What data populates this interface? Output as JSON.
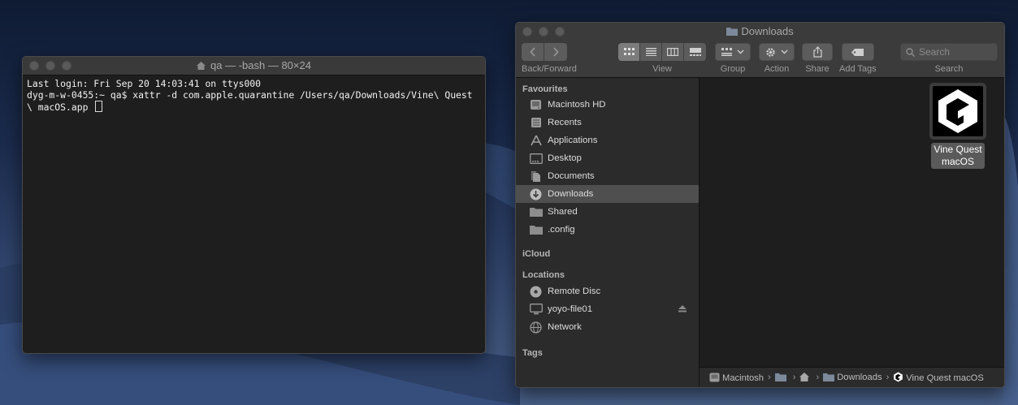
{
  "terminal": {
    "title": "qa — -bash — 80×24",
    "lines": [
      "Last login: Fri Sep 20 14:03:41 on ttys000",
      "dyg-m-w-0455:~ qa$ xattr -d com.apple.quarantine /Users/qa/Downloads/Vine\\ Quest",
      "\\ macOS.app "
    ]
  },
  "finder": {
    "title": "Downloads",
    "toolbar": {
      "back_forward_label": "Back/Forward",
      "view_label": "View",
      "group_label": "Group",
      "action_label": "Action",
      "share_label": "Share",
      "add_tags_label": "Add Tags",
      "search_label": "Search",
      "search_placeholder": "Search"
    },
    "sidebar": {
      "favourites_heading": "Favourites",
      "favourites": [
        {
          "label": "Macintosh HD",
          "icon": "hard-drive-icon"
        },
        {
          "label": "Recents",
          "icon": "recents-icon"
        },
        {
          "label": "Applications",
          "icon": "applications-icon"
        },
        {
          "label": "Desktop",
          "icon": "desktop-icon"
        },
        {
          "label": "Documents",
          "icon": "documents-icon"
        },
        {
          "label": "Downloads",
          "icon": "downloads-icon",
          "selected": true
        },
        {
          "label": "Shared",
          "icon": "folder-icon"
        },
        {
          "label": ".config",
          "icon": "folder-icon"
        }
      ],
      "icloud_heading": "iCloud",
      "locations_heading": "Locations",
      "locations": [
        {
          "label": "Remote Disc",
          "icon": "disc-icon"
        },
        {
          "label": "yoyo-file01",
          "icon": "display-icon"
        },
        {
          "label": "Network",
          "icon": "network-icon"
        }
      ],
      "tags_heading": "Tags"
    },
    "files": [
      {
        "name_line1": "Vine Quest",
        "name_line2": "macOS",
        "icon": "app-icon"
      }
    ],
    "pathbar": {
      "items": [
        "Macintosh",
        "",
        "",
        "Downloads",
        "Vine Quest macOS"
      ]
    }
  }
}
